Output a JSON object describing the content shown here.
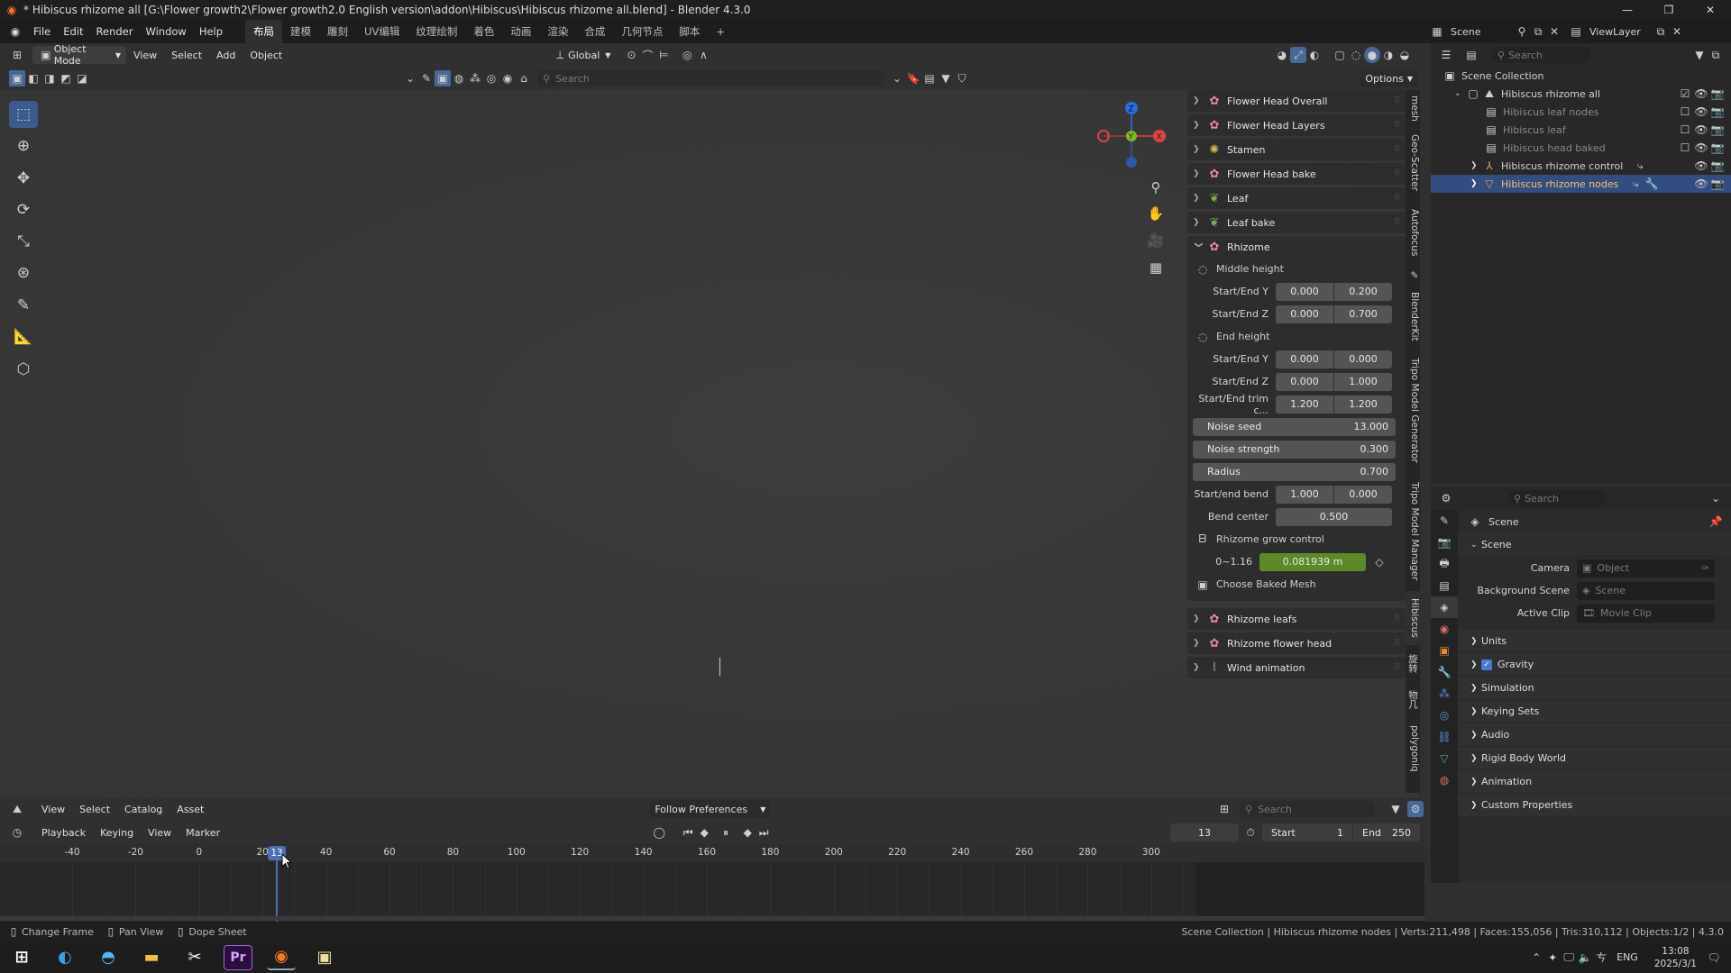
{
  "title_bar": {
    "title": "* Hibiscus rhizome all [G:\\Flower growth2\\Flower growth2.0 English version\\addon\\Hibiscus\\Hibiscus rhizome all.blend] - Blender 4.3.0"
  },
  "menubar": {
    "items": [
      "File",
      "Edit",
      "Render",
      "Window",
      "Help"
    ],
    "workspaces": [
      "布局",
      "建模",
      "雕刻",
      "UV编辑",
      "纹理绘制",
      "着色",
      "动画",
      "渲染",
      "合成",
      "几何节点",
      "脚本"
    ],
    "active_workspace": "布局",
    "scene_label": "Scene",
    "view_layer_label": "ViewLayer"
  },
  "viewport_header": {
    "mode": "Object Mode",
    "menus": [
      "View",
      "Select",
      "Add",
      "Object"
    ],
    "orientation": "Global",
    "search_placeholder": "Search",
    "options": "Options"
  },
  "npanel": {
    "collapsed_top": [
      "Flower Head Overall",
      "Flower Head Layers",
      "Stamen",
      "Flower Head bake",
      "Leaf",
      "Leaf bake"
    ],
    "rhizome": {
      "label": "Rhizome",
      "middle_height": "Middle height",
      "end_height": "End height",
      "rows_mid": [
        {
          "label": "Start/End Y",
          "a": "0.000",
          "b": "0.200"
        },
        {
          "label": "Start/End Z",
          "a": "0.000",
          "b": "0.700"
        }
      ],
      "rows_end": [
        {
          "label": "Start/End Y",
          "a": "0.000",
          "b": "0.000"
        },
        {
          "label": "Start/End Z",
          "a": "0.000",
          "b": "1.000"
        },
        {
          "label": "Start/End trim c...",
          "a": "1.200",
          "b": "1.200"
        }
      ],
      "noise_seed": {
        "label": "Noise seed",
        "value": "13.000"
      },
      "noise_strength": {
        "label": "Noise strength",
        "value": "0.300"
      },
      "radius": {
        "label": "Radius",
        "value": "0.700"
      },
      "bend": {
        "label": "Start/end bend",
        "a": "1.000",
        "b": "0.000"
      },
      "bend_center": {
        "label": "Bend center",
        "value": "0.500"
      },
      "grow_control": "Rhizome grow control",
      "grow_range": "0~1.16",
      "grow_value": "0.081939 m",
      "choose_baked": "Choose Baked Mesh"
    },
    "collapsed_bottom": [
      "Rhizome leafs",
      "Rhizome flower head",
      "Wind animation"
    ]
  },
  "vertical_tabs": [
    "mesh",
    "Geo-Scatter",
    "Autofocus",
    "BlenderKit",
    "Tripo Model Generator",
    "Tripo Model Manager",
    "Hibiscus",
    "旋转",
    "物几",
    "polygoniq"
  ],
  "outliner": {
    "search_placeholder": "Search",
    "root": "Scene Collection",
    "collection": "Hibiscus rhizome all",
    "items": [
      "Hibiscus leaf nodes",
      "Hibiscus leaf",
      "Hibiscus head baked",
      "Hibiscus rhizome control",
      "Hibiscus rhizome nodes"
    ]
  },
  "properties": {
    "search_placeholder": "Search",
    "crumb": "Scene",
    "section": "Scene",
    "camera_label": "Camera",
    "camera_value": "Object",
    "bg_label": "Background Scene",
    "bg_value": "Scene",
    "clip_label": "Active Clip",
    "clip_value": "Movie Clip",
    "sections": [
      "Units",
      "Gravity",
      "Simulation",
      "Keying Sets",
      "Audio",
      "Rigid Body World",
      "Animation",
      "Custom Properties"
    ]
  },
  "asset_header": {
    "menus": [
      "View",
      "Select",
      "Catalog",
      "Asset"
    ],
    "follow": "Follow Preferences",
    "search_placeholder": "Search"
  },
  "timeline": {
    "menus": [
      "Playback",
      "Keying",
      "View",
      "Marker"
    ],
    "current_frame": "13",
    "start_label": "Start",
    "start": "1",
    "end_label": "End",
    "end": "250",
    "ticks": [
      "-40",
      "-20",
      "0",
      "20",
      "40",
      "60",
      "80",
      "100",
      "120",
      "140",
      "160",
      "180",
      "200",
      "220",
      "240",
      "260",
      "280",
      "300"
    ]
  },
  "statusbar": {
    "left": [
      "Change Frame",
      "Pan View",
      "Dope Sheet"
    ],
    "right": "Scene Collection | Hibiscus rhizome nodes | Verts:211,498 | Faces:155,056 | Tris:310,112 | Objects:1/2 | 4.3.0"
  },
  "taskbar": {
    "lang": "ENG",
    "time": "13:08",
    "date": "2025/3/1"
  }
}
